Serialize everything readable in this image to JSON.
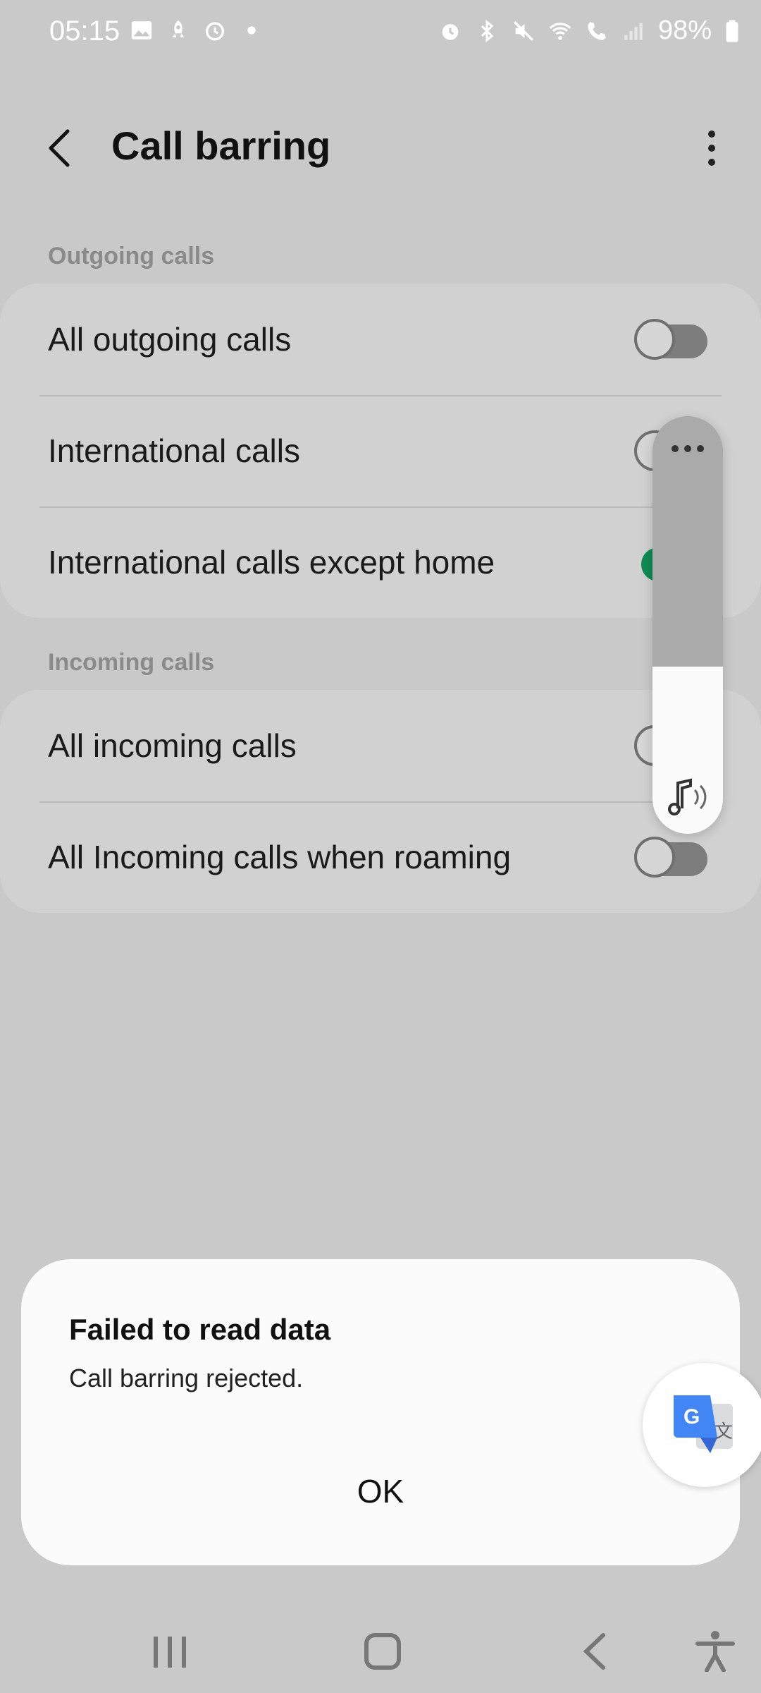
{
  "status_bar": {
    "time": "05:15",
    "battery_percent": "98%",
    "left_icons": [
      "gallery-icon",
      "rocket-icon",
      "alarm-icon",
      "dot-icon"
    ],
    "right_icons": [
      "alarm-icon",
      "bluetooth-icon",
      "mute-icon",
      "wifi-icon",
      "wifi-call-icon",
      "signal-icon",
      "battery-icon"
    ]
  },
  "app_bar": {
    "title": "Call barring"
  },
  "sections": [
    {
      "header": "Outgoing calls",
      "items": [
        {
          "label": "All outgoing calls",
          "on": false
        },
        {
          "label": "International calls",
          "on": false
        },
        {
          "label": "International calls except home",
          "on": true
        }
      ]
    },
    {
      "header": "Incoming calls",
      "items": [
        {
          "label": "All incoming calls",
          "on": false
        },
        {
          "label": "All Incoming calls when roaming",
          "on": false
        }
      ]
    }
  ],
  "volume_panel": {
    "level": 0.4,
    "icon": "music-note-icon"
  },
  "dialog": {
    "title": "Failed to read data",
    "message": "Call barring rejected.",
    "ok_label": "OK"
  },
  "colors": {
    "background": "#c9c9c9",
    "toggle_on": "#0f8a55",
    "toggle_off": "#7d7d7d",
    "dialog": "#fbfbfb"
  }
}
